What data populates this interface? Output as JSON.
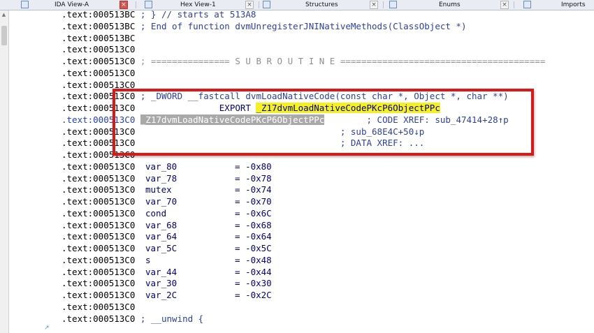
{
  "tabs": [
    {
      "label": "IDA View-A",
      "active": true
    },
    {
      "label": "Hex View-1",
      "active": false
    },
    {
      "label": "Structures",
      "active": false
    },
    {
      "label": "Enums",
      "active": false
    },
    {
      "label": "Imports",
      "active": false
    }
  ],
  "close_glyph": "×",
  "lines": [
    {
      "addr": ".text:000513BC",
      "comment": " ; } // starts at 513A8"
    },
    {
      "addr": ".text:000513BC",
      "comment": " ; End of function dvmUnregisterJNINativeMethods(ClassObject *)"
    },
    {
      "addr": ".text:000513BC"
    },
    {
      "addr": ".text:000513C0"
    },
    {
      "addr": ".text:000513C0",
      "subroutine": " ; =============== S U B R O U T I N E ======================================="
    },
    {
      "addr": ".text:000513C0"
    },
    {
      "addr": ".text:000513C0"
    },
    {
      "addr": ".text:000513C0",
      "comment": " ; _DWORD __fastcall dvmLoadNativeCode(const char *, Object *, char **)"
    },
    {
      "addr": ".text:000513C0",
      "export_kw": "                EXPORT ",
      "export_name": "_Z17dvmLoadNativeCodePKcP6ObjectPPc"
    },
    {
      "addr": ".text:000513C0",
      "selected": true,
      "label": "_Z17dvmLoadNativeCodePKcP6ObjectPPc",
      "xref": "        ; CODE XREF: sub_47414+28↑p"
    },
    {
      "addr": ".text:000513C0",
      "xref": "                                       ; sub_68E4C+50↓p"
    },
    {
      "addr": ".text:000513C0",
      "xref": "                                       ; DATA XREF: ..."
    },
    {
      "addr": ".text:000513C0"
    },
    {
      "addr": ".text:000513C0",
      "var": "var_80",
      "value": "-0x80"
    },
    {
      "addr": ".text:000513C0",
      "var": "var_78",
      "value": "-0x78"
    },
    {
      "addr": ".text:000513C0",
      "var": "mutex",
      "value": "-0x74"
    },
    {
      "addr": ".text:000513C0",
      "var": "var_70",
      "value": "-0x70"
    },
    {
      "addr": ".text:000513C0",
      "var": "cond",
      "value": "-0x6C"
    },
    {
      "addr": ".text:000513C0",
      "var": "var_68",
      "value": "-0x68"
    },
    {
      "addr": ".text:000513C0",
      "var": "var_64",
      "value": "-0x64"
    },
    {
      "addr": ".text:000513C0",
      "var": "var_5C",
      "value": "-0x5C"
    },
    {
      "addr": ".text:000513C0",
      "var": "s",
      "value": "-0x48"
    },
    {
      "addr": ".text:000513C0",
      "var": "var_44",
      "value": "-0x44"
    },
    {
      "addr": ".text:000513C0",
      "var": "var_30",
      "value": "-0x30"
    },
    {
      "addr": ".text:000513C0",
      "var": "var_2C",
      "value": "-0x2C"
    },
    {
      "addr": ".text:000513C0"
    },
    {
      "addr": ".text:000513C0",
      "comment": " ; __unwind {"
    }
  ],
  "colors": {
    "highlight": "#f6f01e",
    "annotation_box": "#e01616",
    "selection": "#a9a9a9"
  }
}
